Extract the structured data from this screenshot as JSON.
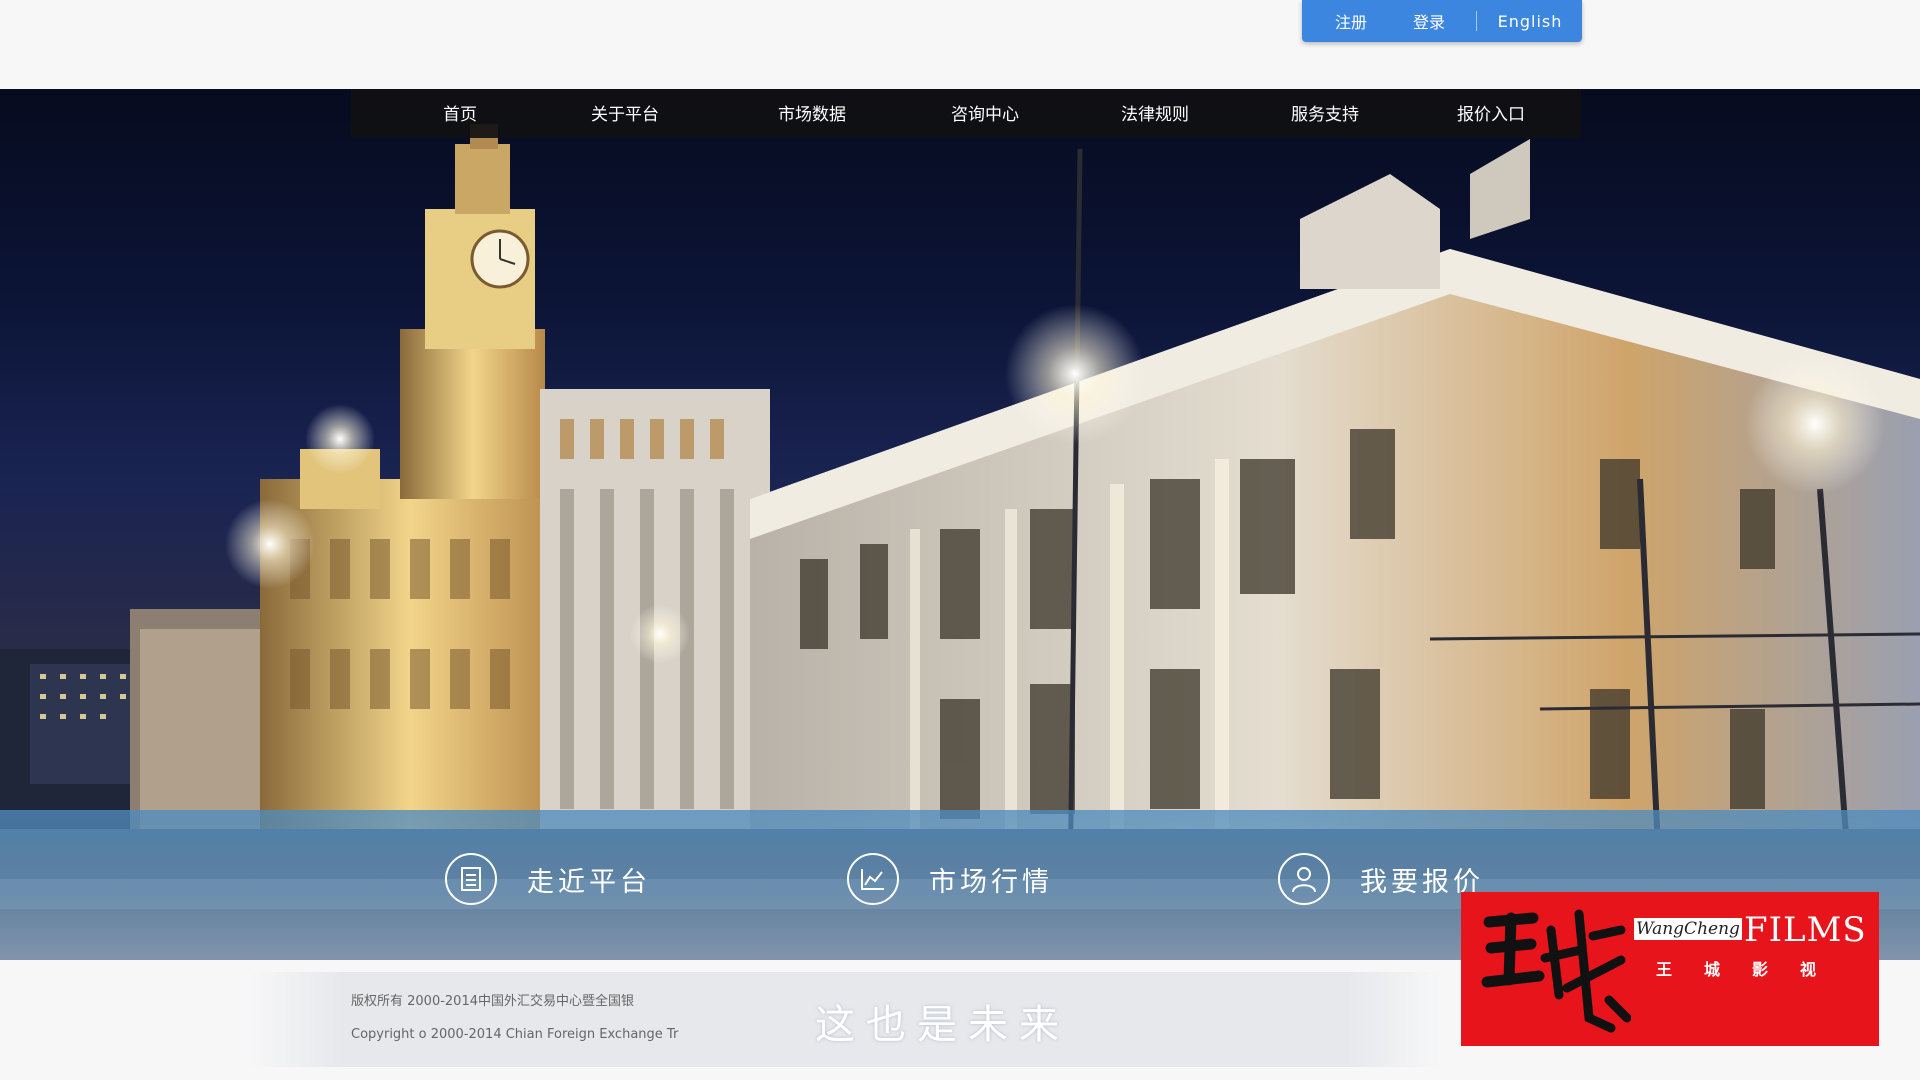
{
  "account": {
    "register": "注册",
    "login": "登录",
    "language": "English"
  },
  "nav": [
    "首页",
    "关于平台",
    "市场数据",
    "咨询中心",
    "法律规则",
    "服务支持",
    "报价入口"
  ],
  "features": [
    {
      "label": "走近平台",
      "icon": "document-icon"
    },
    {
      "label": "市场行情",
      "icon": "chart-line-icon"
    },
    {
      "label": "我要报价",
      "icon": "user-icon"
    }
  ],
  "footer": {
    "copyright_cn": "版权所有 2000-2014中国外汇交易中心暨全国银",
    "copyright_en": "Copyright o 2000-2014 Chian Foreign Exchange Tr",
    "slogan": "这也是未来"
  },
  "watermark": {
    "calligraphy": "王城",
    "tag": "WangCheng",
    "films": "FILMS",
    "subtitle": "王城影视"
  },
  "colors": {
    "accent": "#3d86e0",
    "nav_bg": "#101014",
    "band": "#4e8cbe",
    "watermark": "#e8141c"
  }
}
